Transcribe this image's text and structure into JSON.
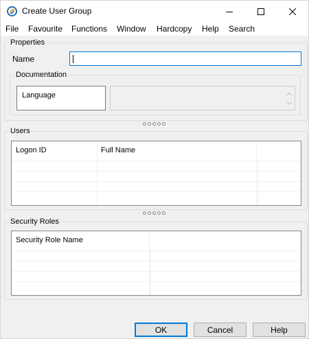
{
  "window": {
    "title": "Create User Group"
  },
  "icons": {
    "app": "app-logo-icon",
    "minimize": "minimize-icon",
    "maximize": "maximize-icon",
    "close": "close-icon",
    "scroll_up": "scroll-up-icon",
    "scroll_down": "scroll-down-icon"
  },
  "menu": [
    "File",
    "Favourite",
    "Functions",
    "Window",
    "Hardcopy",
    "Help",
    "Search"
  ],
  "properties": {
    "label": "Properties",
    "name_label": "Name",
    "name_value": "",
    "documentation": {
      "label": "Documentation",
      "language_label": "Language"
    }
  },
  "users": {
    "label": "Users",
    "columns": [
      "Logon ID",
      "Full Name"
    ]
  },
  "security_roles": {
    "label": "Security Roles",
    "columns": [
      "Security Role Name"
    ]
  },
  "buttons": {
    "ok": "OK",
    "cancel": "Cancel",
    "help": "Help"
  },
  "colors": {
    "accent": "#0078d7",
    "window_bg": "#f0f0f0"
  }
}
